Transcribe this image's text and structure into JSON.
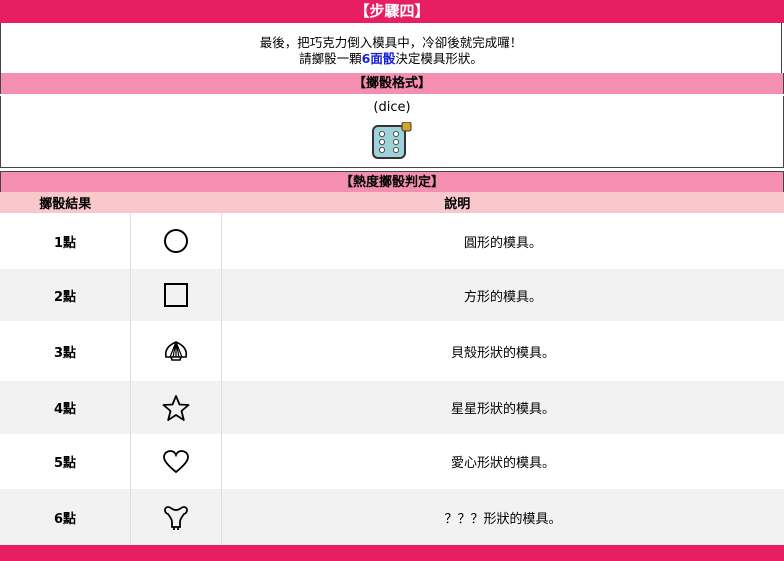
{
  "step": {
    "title": "【步驟四】"
  },
  "intro": {
    "line1": "最後，把巧克力倒入模具中，冷卻後就完成囉！",
    "line2_prefix": "請擲骰一顆",
    "line2_highlight": "6面骰",
    "line2_suffix": "決定模具形狀。"
  },
  "dice_format": {
    "title": "【擲骰格式】",
    "code": "(dice)",
    "icon": "dice-icon"
  },
  "judgement": {
    "title": "【熱度擲骰判定】",
    "col_result": "擲骰結果",
    "col_desc": "說明",
    "rows": [
      {
        "result": "1點",
        "icon": "circle-icon",
        "desc": "圓形的模具。"
      },
      {
        "result": "2點",
        "icon": "square-icon",
        "desc": "方形的模具。"
      },
      {
        "result": "3點",
        "icon": "shell-icon",
        "desc": "貝殼形狀的模具。"
      },
      {
        "result": "4點",
        "icon": "star-icon",
        "desc": "星星形狀的模具。"
      },
      {
        "result": "5點",
        "icon": "heart-icon",
        "desc": "愛心形狀的模具。"
      },
      {
        "result": "6點",
        "icon": "mystery-icon",
        "desc": "？？？形狀的模具。"
      }
    ]
  },
  "colors": {
    "header": "#e81e63",
    "subheader": "#f48fb1",
    "table_header": "#f8c8cc",
    "highlight": "#1a22d4"
  }
}
